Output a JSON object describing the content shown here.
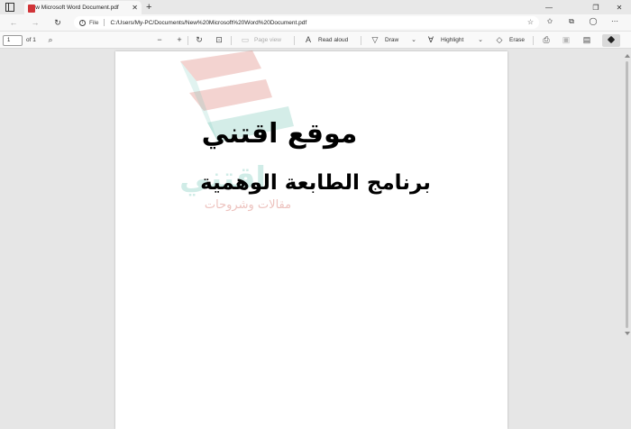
{
  "browser": {
    "tab_title": "New Microsoft Word Document.pdf",
    "new_tab": "+",
    "address": {
      "scheme_label": "File",
      "url": "C:/Users/My-PC/Documents/New%20Microsoft%20Word%20Document.pdf"
    }
  },
  "pdf_toolbar": {
    "page_number": "1",
    "page_total": "of 1",
    "page_view": "Page view",
    "read_aloud": "Read aloud",
    "draw": "Draw",
    "highlight": "Highlight",
    "erase": "Erase"
  },
  "document": {
    "heading": "موقع اقتني",
    "subheading": "برنامج الطابعة الوهمية"
  },
  "watermark": {
    "word": "اقتني",
    "subtitle": "مقالات وشروحات"
  },
  "colors": {
    "accent_pdf": "#d13438",
    "watermark_teal": "#78c8b9",
    "watermark_red": "#d7786e"
  }
}
